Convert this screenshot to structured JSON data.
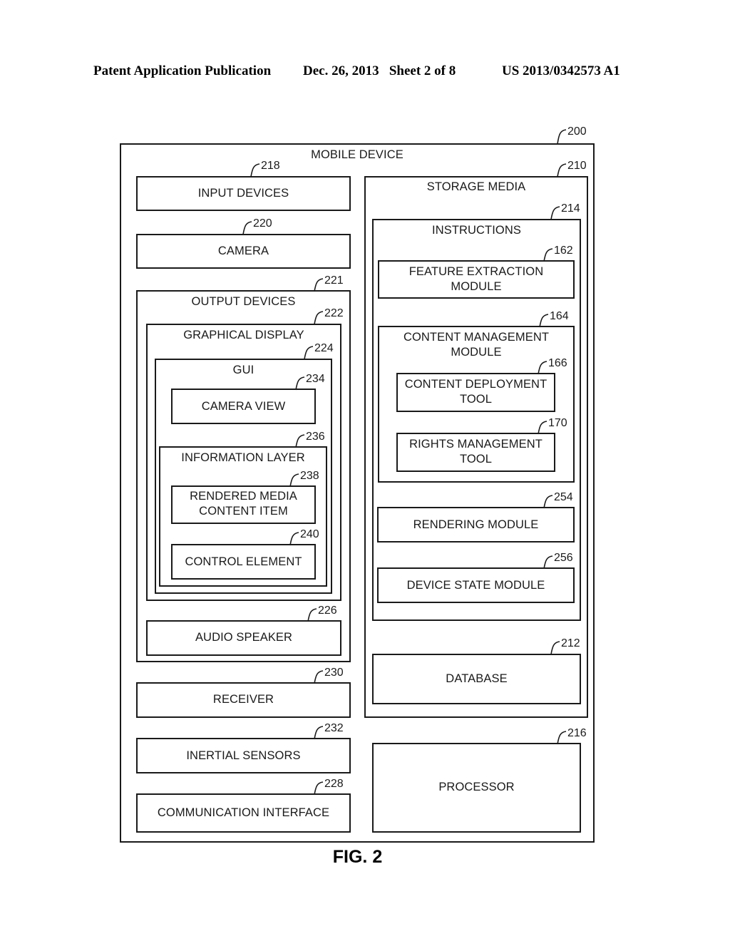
{
  "header": {
    "publication": "Patent Application Publication",
    "date_sheet": "Dec. 26, 2013   Sheet 2 of 8",
    "number": "US 2013/0342573 A1"
  },
  "figure_label": "FIG. 2",
  "diagram": {
    "mobile_device": {
      "label": "MOBILE DEVICE",
      "ref": "200"
    },
    "input_devices": {
      "label": "INPUT DEVICES",
      "ref": "218"
    },
    "camera": {
      "label": "CAMERA",
      "ref": "220"
    },
    "output_devices": {
      "label": "OUTPUT DEVICES",
      "ref": "221"
    },
    "graphical_display": {
      "label": "GRAPHICAL DISPLAY",
      "ref": "222"
    },
    "gui": {
      "label": "GUI",
      "ref": "224"
    },
    "camera_view": {
      "label": "CAMERA VIEW",
      "ref": "234"
    },
    "information_layer": {
      "label": "INFORMATION LAYER",
      "ref": "236"
    },
    "rendered_media": {
      "label": "RENDERED MEDIA\nCONTENT ITEM",
      "ref": "238"
    },
    "control_element": {
      "label": "CONTROL ELEMENT",
      "ref": "240"
    },
    "audio_speaker": {
      "label": "AUDIO SPEAKER",
      "ref": "226"
    },
    "receiver": {
      "label": "RECEIVER",
      "ref": "230"
    },
    "inertial_sensors": {
      "label": "INERTIAL SENSORS",
      "ref": "232"
    },
    "communication_interface": {
      "label": "COMMUNICATION INTERFACE",
      "ref": "228"
    },
    "storage_media": {
      "label": "STORAGE MEDIA",
      "ref": "210"
    },
    "instructions": {
      "label": "INSTRUCTIONS",
      "ref": "214"
    },
    "feature_extraction": {
      "label": "FEATURE EXTRACTION\nMODULE",
      "ref": "162"
    },
    "content_management": {
      "label": "CONTENT MANAGEMENT\nMODULE",
      "ref": "164"
    },
    "content_deployment": {
      "label": "CONTENT DEPLOYMENT\nTOOL",
      "ref": "166"
    },
    "rights_management": {
      "label": "RIGHTS MANAGEMENT\nTOOL",
      "ref": "170"
    },
    "rendering_module": {
      "label": "RENDERING MODULE",
      "ref": "254"
    },
    "device_state_module": {
      "label": "DEVICE STATE MODULE",
      "ref": "256"
    },
    "database": {
      "label": "DATABASE",
      "ref": "212"
    },
    "processor": {
      "label": "PROCESSOR",
      "ref": "216"
    }
  }
}
